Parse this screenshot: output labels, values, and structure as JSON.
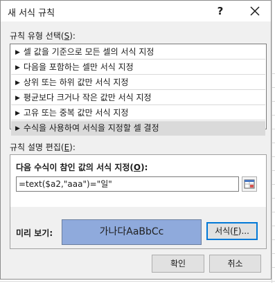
{
  "window": {
    "title": "새 서식 규칙",
    "help_label": "?"
  },
  "rule_type": {
    "label_prefix": "규칙 유형 선택(",
    "label_key": "S",
    "label_suffix": "):",
    "items": [
      {
        "label": "셀 값을 기준으로 모든 셀의 서식 지정"
      },
      {
        "label": "다음을 포함하는 셀만 서식 지정"
      },
      {
        "label": "상위 또는 하위 값만 서식 지정"
      },
      {
        "label": "평균보다 크거나 작은 값만 서식 지정"
      },
      {
        "label": "고유 또는 중복 값만 서식 지정"
      },
      {
        "label": "수식을 사용하여 서식을 지정할 셀 결정"
      }
    ],
    "selected_index": 5
  },
  "rule_description": {
    "label_prefix": "규칙 설명 편집(",
    "label_key": "E",
    "label_suffix": "):",
    "formula_label_prefix": "다음 수식이 참인 값의 서식 지정(",
    "formula_label_key": "O",
    "formula_label_suffix": "):",
    "formula_value": "=text($a2,\"aaa\")=\"일\"",
    "preview_label": "미리 보기:",
    "preview_text": "가나다AaBbCc",
    "preview_fill_color": "#8faadc",
    "format_button_prefix": "서식(",
    "format_button_key": "F",
    "format_button_suffix": ")..."
  },
  "buttons": {
    "ok_label": "확인",
    "cancel_label": "취소"
  }
}
